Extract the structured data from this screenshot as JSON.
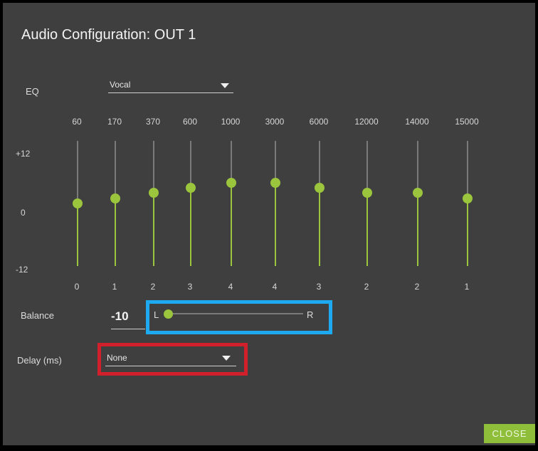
{
  "dialog": {
    "title": "Audio Configuration: OUT 1",
    "close_label": "CLOSE"
  },
  "eq": {
    "label": "EQ",
    "preset": "Vocal",
    "scale": {
      "max": "+12",
      "mid": "0",
      "min": "-12"
    },
    "bands": [
      {
        "freq": "60",
        "gain": "0"
      },
      {
        "freq": "170",
        "gain": "1"
      },
      {
        "freq": "370",
        "gain": "2"
      },
      {
        "freq": "600",
        "gain": "3"
      },
      {
        "freq": "1000",
        "gain": "4"
      },
      {
        "freq": "3000",
        "gain": "4"
      },
      {
        "freq": "6000",
        "gain": "3"
      },
      {
        "freq": "12000",
        "gain": "2"
      },
      {
        "freq": "14000",
        "gain": "2"
      },
      {
        "freq": "15000",
        "gain": "1"
      }
    ]
  },
  "balance": {
    "label": "Balance",
    "value": "-10",
    "left_label": "L",
    "right_label": "R",
    "highlight_color": "#1eaaf1"
  },
  "delay": {
    "label": "Delay (ms)",
    "value": "None",
    "highlight_color": "#d0202c"
  },
  "colors": {
    "accent": "#9bc53d",
    "background": "#3f3f3f"
  }
}
